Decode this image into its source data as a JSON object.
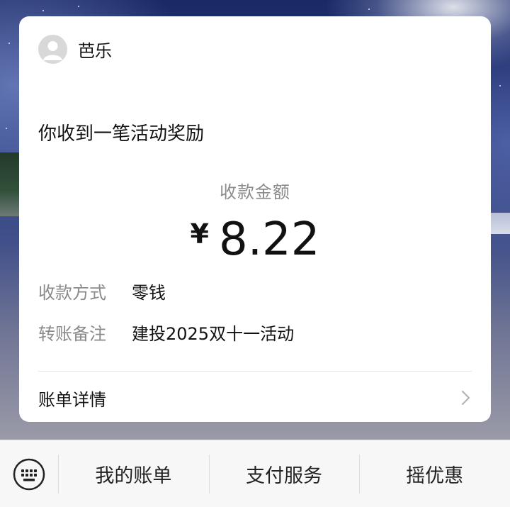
{
  "sender": {
    "name": "芭乐",
    "avatar_icon": "default-avatar-icon"
  },
  "message": "你收到一笔活动奖励",
  "amount": {
    "label": "收款金额",
    "currency": "¥",
    "value": "8.22"
  },
  "details": [
    {
      "key": "收款方式",
      "value": "零钱"
    },
    {
      "key": "转账备注",
      "value": "建投2025双十一活动"
    }
  ],
  "bill_link": {
    "label": "账单详情",
    "icon": "chevron-right-icon"
  },
  "menu": {
    "keyboard_icon": "keyboard-icon",
    "items": [
      {
        "label": "我的账单"
      },
      {
        "label": "支付服务"
      },
      {
        "label": "摇优惠"
      }
    ]
  },
  "colors": {
    "card_bg": "#ffffff",
    "secondary_text": "#8a8a8a",
    "menubar_bg": "#f7f7f7"
  }
}
